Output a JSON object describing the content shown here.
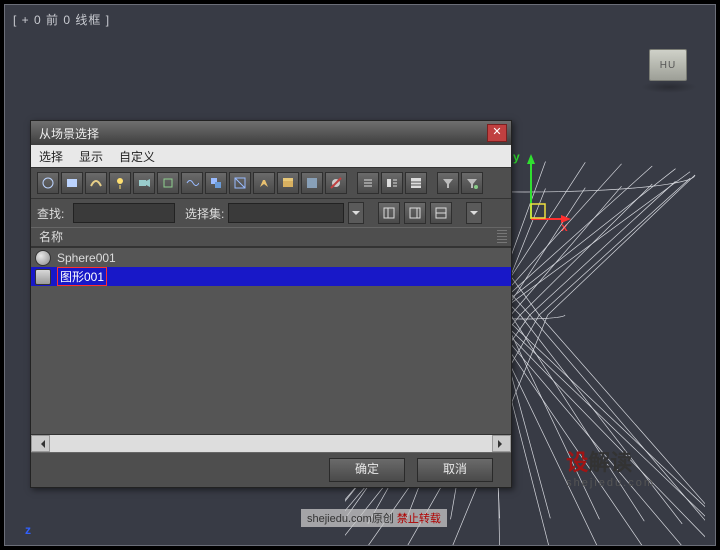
{
  "viewport": {
    "label": "[ + 0 前 0 线框 ]",
    "home": "HU"
  },
  "axes": {
    "x": "x",
    "y": "y",
    "z": "z"
  },
  "dialog": {
    "title": "从场景选择",
    "menu": {
      "select": "选择",
      "display": "显示",
      "custom": "自定义"
    },
    "search_label": "查找:",
    "search_value": "",
    "selset_label": "选择集:",
    "selset_value": "",
    "col_name": "名称",
    "items": [
      {
        "label": "Sphere001",
        "kind": "geom",
        "selected": false
      },
      {
        "label": "图形001",
        "kind": "shape",
        "selected": true
      }
    ],
    "ok": "确定",
    "cancel": "取消"
  },
  "watermark": {
    "brand_red": "设",
    "brand_rest": "解读",
    "brand_sub": "shejiedu.com",
    "footer_a": "shejiedu.com原创 ",
    "footer_b": "禁止转载"
  },
  "icons": {
    "all": "all",
    "geom": "geom",
    "shape": "shape",
    "light": "light",
    "cam": "cam",
    "helper": "helper",
    "space": "space",
    "group": "group",
    "xref": "xref",
    "bone": "bone",
    "container": "container",
    "frozen": "frozen",
    "hidden": "hidden",
    "list1": "list-name",
    "list2": "list-type",
    "list3": "list-color",
    "filter": "filter",
    "filteropt": "filter-opt",
    "tool1": "select-all",
    "tool2": "select-none",
    "tool3": "select-invert",
    "dd": "dd"
  }
}
